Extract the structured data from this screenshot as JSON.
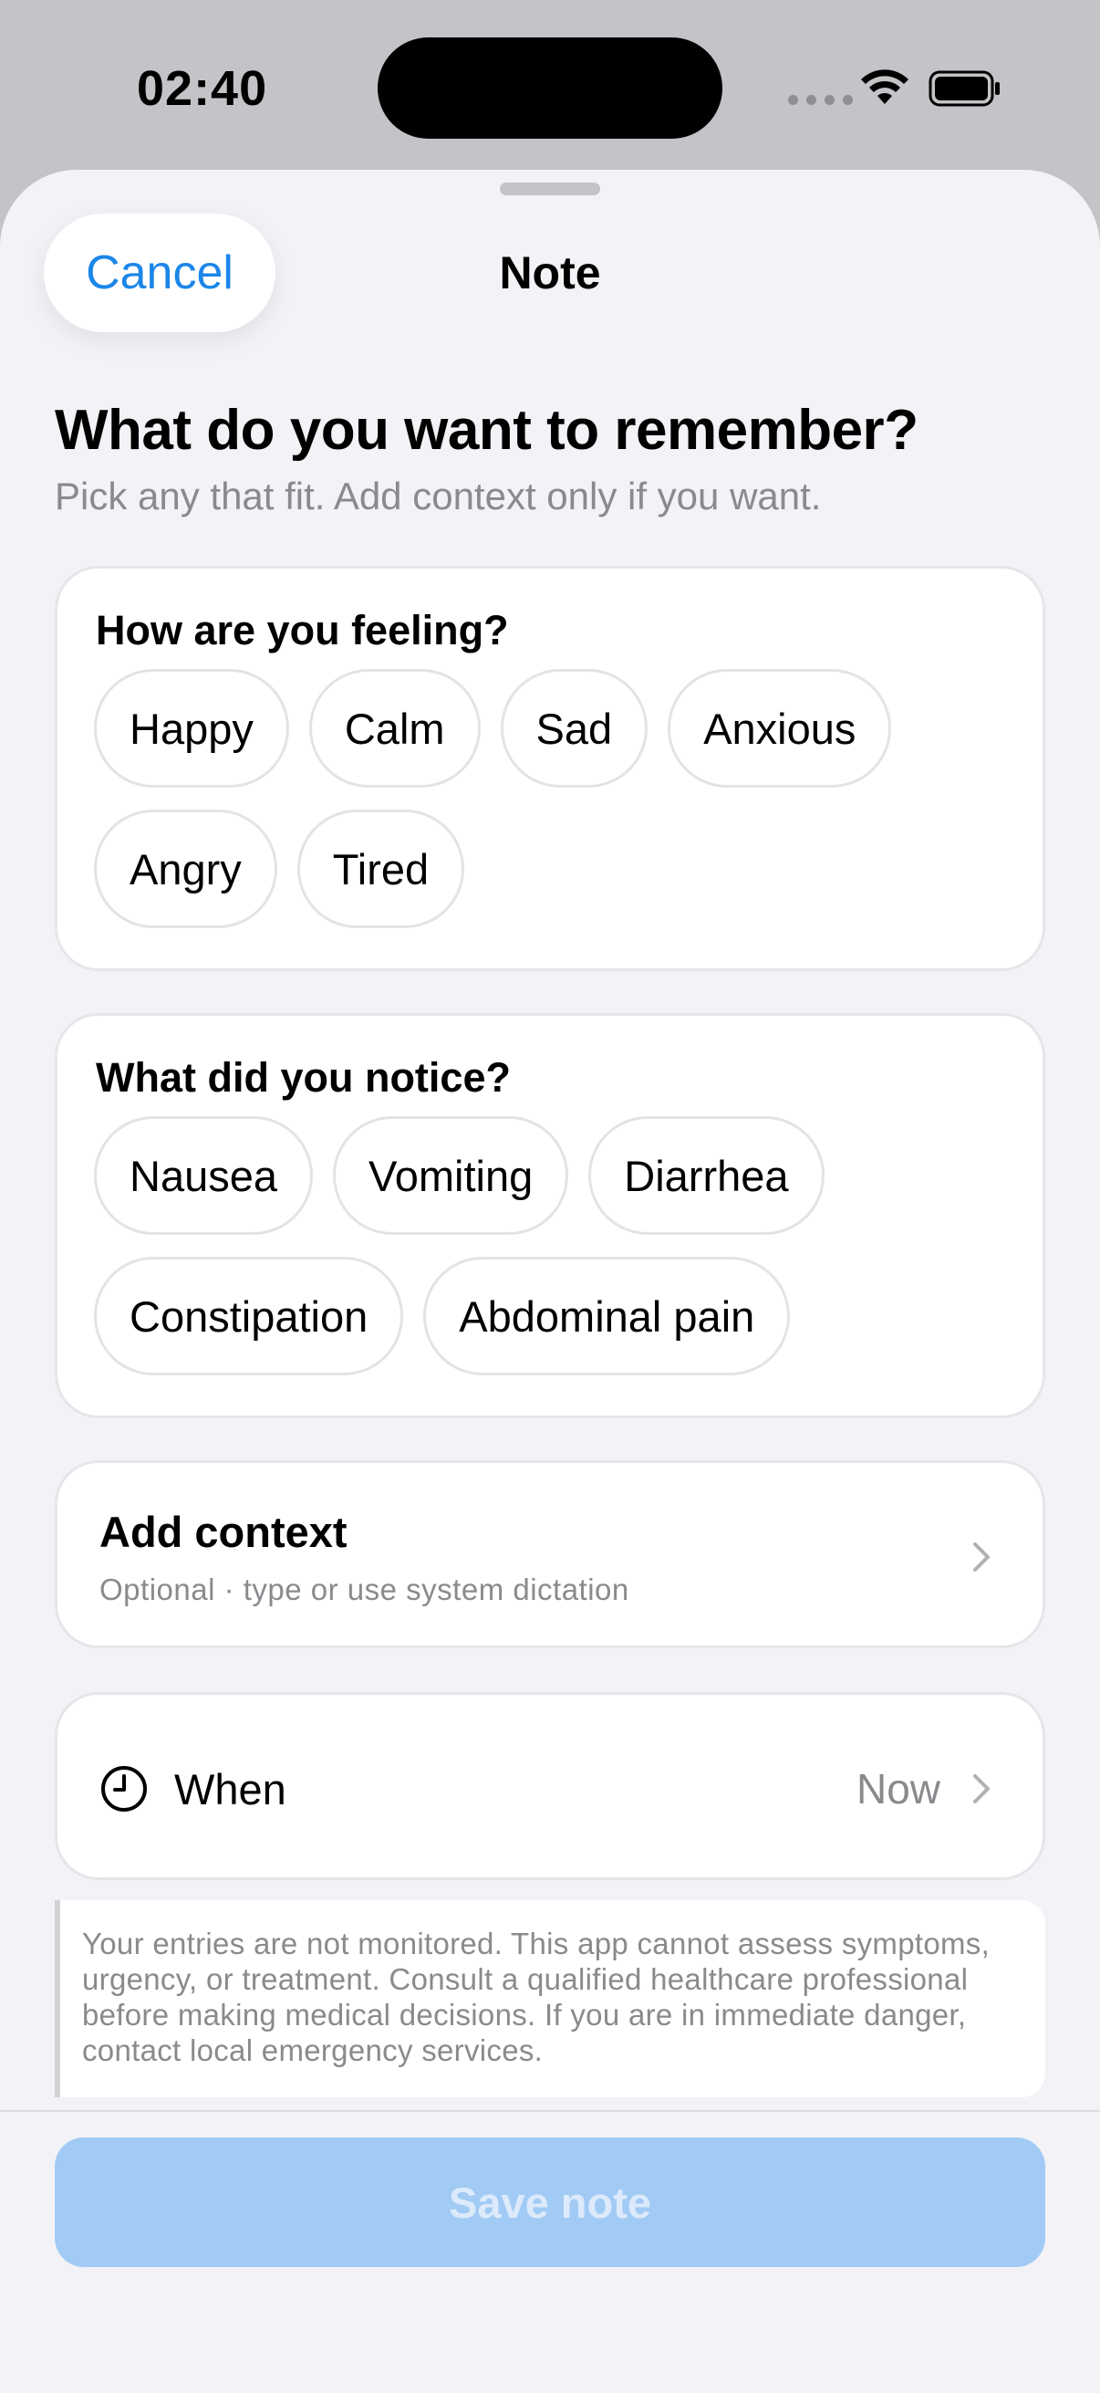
{
  "status_bar": {
    "time": "02:40"
  },
  "nav": {
    "cancel_label": "Cancel",
    "title": "Note"
  },
  "heading": {
    "title": "What do you want to remember?",
    "subtitle": "Pick any that fit. Add context only if you want."
  },
  "feeling": {
    "title": "How are you feeling?",
    "chips": [
      "Happy",
      "Calm",
      "Sad",
      "Anxious",
      "Angry",
      "Tired"
    ]
  },
  "notice": {
    "title": "What did you notice?",
    "chips": [
      "Nausea",
      "Vomiting",
      "Diarrhea",
      "Constipation",
      "Abdominal pain"
    ]
  },
  "context": {
    "title": "Add context",
    "subtitle": "Optional · type or use system dictation"
  },
  "when": {
    "label": "When",
    "value": "Now"
  },
  "disclaimer": "Your entries are not monitored. This app cannot assess symptoms, urgency, or treatment. Consult a qualified healthcare professional before making medical decisions. If you are in immediate danger, contact local emergency services.",
  "save_label": "Save note",
  "colors": {
    "accent": "#1b86e8",
    "save_disabled_bg": "#a1cbf5",
    "sheet_bg": "#f2f2f7"
  },
  "icons": [
    "wifi-icon",
    "battery-icon",
    "clock-icon",
    "chevron-right-icon"
  ]
}
